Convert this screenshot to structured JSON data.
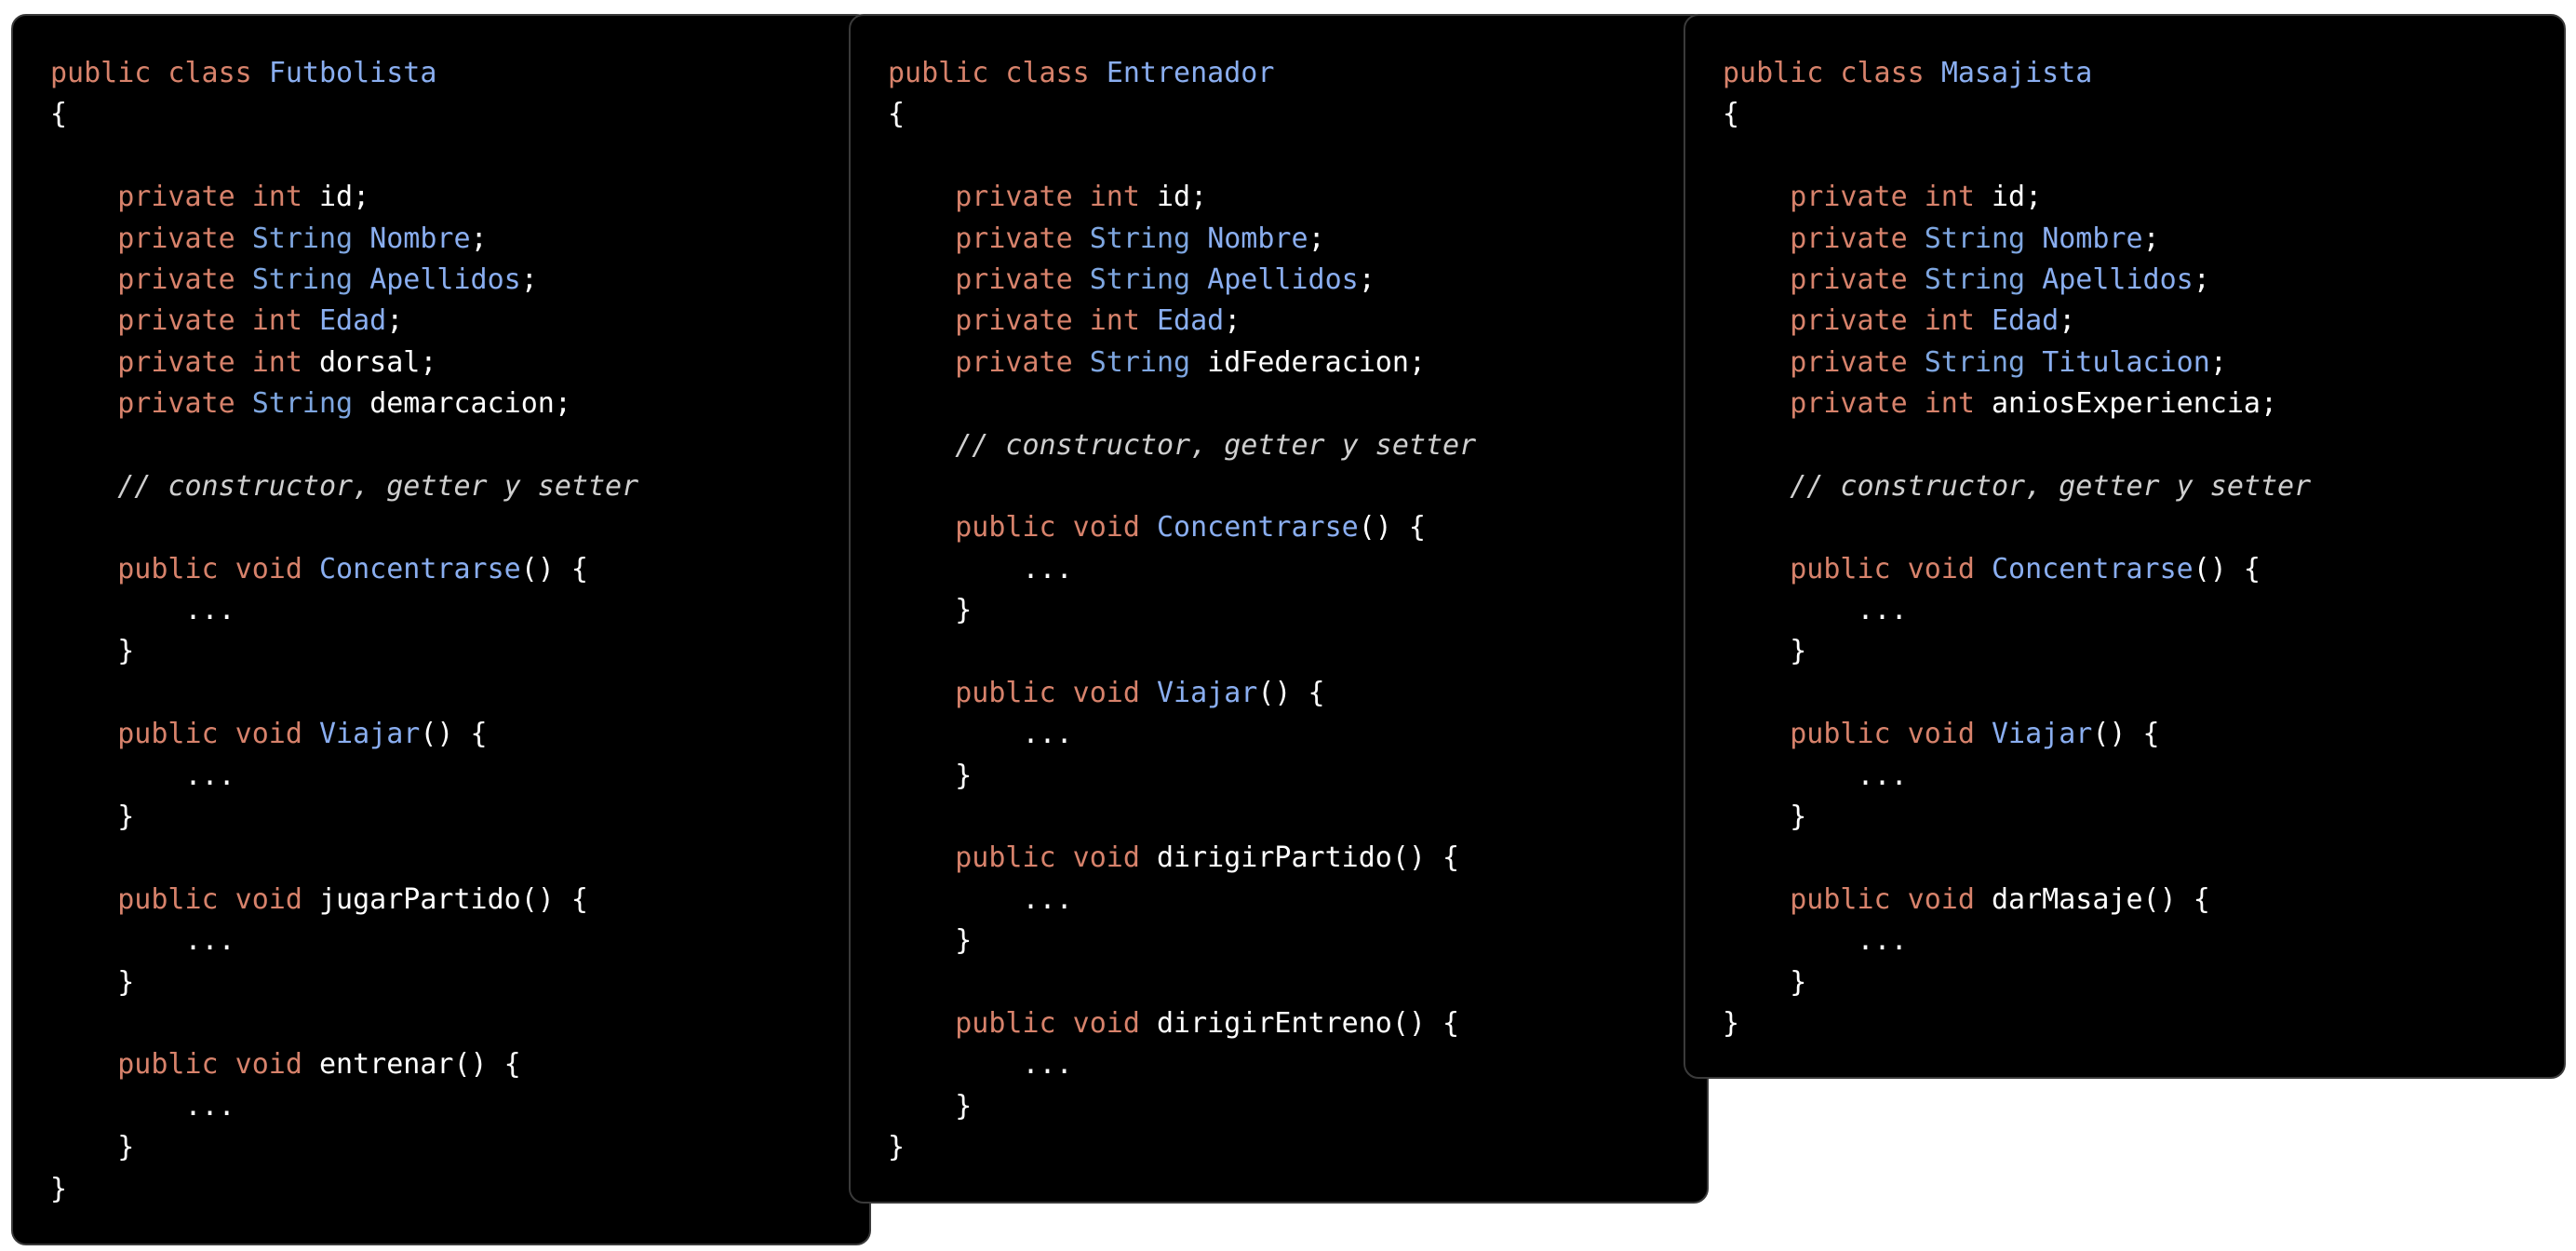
{
  "colors": {
    "background": "#ffffff",
    "panel": "#000000",
    "keyword": "#d7826b",
    "type": "#7ea6e0",
    "identifier": "#8aaef0",
    "plain": "#ffffff",
    "comment": "#cfcfcf"
  },
  "panels": [
    {
      "id": "futbolista",
      "lines": [
        [
          {
            "t": "kw",
            "v": "public class "
          },
          {
            "t": "name",
            "v": "Futbolista"
          }
        ],
        [
          {
            "t": "plain",
            "v": "{"
          }
        ],
        [],
        [
          {
            "t": "plain",
            "v": "\t"
          },
          {
            "t": "kw",
            "v": "private "
          },
          {
            "t": "kw",
            "v": "int "
          },
          {
            "t": "plain",
            "v": "id;"
          }
        ],
        [
          {
            "t": "plain",
            "v": "\t"
          },
          {
            "t": "kw",
            "v": "private "
          },
          {
            "t": "type",
            "v": "String "
          },
          {
            "t": "name",
            "v": "Nombre"
          },
          {
            "t": "plain",
            "v": ";"
          }
        ],
        [
          {
            "t": "plain",
            "v": "\t"
          },
          {
            "t": "kw",
            "v": "private "
          },
          {
            "t": "type",
            "v": "String "
          },
          {
            "t": "name",
            "v": "Apellidos"
          },
          {
            "t": "plain",
            "v": ";"
          }
        ],
        [
          {
            "t": "plain",
            "v": "\t"
          },
          {
            "t": "kw",
            "v": "private "
          },
          {
            "t": "kw",
            "v": "int "
          },
          {
            "t": "name",
            "v": "Edad"
          },
          {
            "t": "plain",
            "v": ";"
          }
        ],
        [
          {
            "t": "plain",
            "v": "\t"
          },
          {
            "t": "kw",
            "v": "private "
          },
          {
            "t": "kw",
            "v": "int "
          },
          {
            "t": "plain",
            "v": "dorsal;"
          }
        ],
        [
          {
            "t": "plain",
            "v": "\t"
          },
          {
            "t": "kw",
            "v": "private "
          },
          {
            "t": "type",
            "v": "String "
          },
          {
            "t": "plain",
            "v": "demarcacion;"
          }
        ],
        [],
        [
          {
            "t": "plain",
            "v": "\t"
          },
          {
            "t": "com",
            "v": "// constructor, getter y setter"
          }
        ],
        [],
        [
          {
            "t": "plain",
            "v": "\t"
          },
          {
            "t": "kw",
            "v": "public void "
          },
          {
            "t": "name",
            "v": "Concentrarse"
          },
          {
            "t": "plain",
            "v": "() {"
          }
        ],
        [
          {
            "t": "plain",
            "v": "\t\t..."
          }
        ],
        [
          {
            "t": "plain",
            "v": "\t}"
          }
        ],
        [],
        [
          {
            "t": "plain",
            "v": "\t"
          },
          {
            "t": "kw",
            "v": "public void "
          },
          {
            "t": "name",
            "v": "Viajar"
          },
          {
            "t": "plain",
            "v": "() {"
          }
        ],
        [
          {
            "t": "plain",
            "v": "\t\t..."
          }
        ],
        [
          {
            "t": "plain",
            "v": "\t}"
          }
        ],
        [],
        [
          {
            "t": "plain",
            "v": "\t"
          },
          {
            "t": "kw",
            "v": "public void "
          },
          {
            "t": "plain",
            "v": "jugarPartido() {"
          }
        ],
        [
          {
            "t": "plain",
            "v": "\t\t..."
          }
        ],
        [
          {
            "t": "plain",
            "v": "\t}"
          }
        ],
        [],
        [
          {
            "t": "plain",
            "v": "\t"
          },
          {
            "t": "kw",
            "v": "public void "
          },
          {
            "t": "plain",
            "v": "entrenar() {"
          }
        ],
        [
          {
            "t": "plain",
            "v": "\t\t..."
          }
        ],
        [
          {
            "t": "plain",
            "v": "\t}"
          }
        ],
        [
          {
            "t": "plain",
            "v": "}"
          }
        ]
      ]
    },
    {
      "id": "entrenador",
      "lines": [
        [
          {
            "t": "kw",
            "v": "public class "
          },
          {
            "t": "name",
            "v": "Entrenador"
          }
        ],
        [
          {
            "t": "plain",
            "v": "{"
          }
        ],
        [],
        [
          {
            "t": "plain",
            "v": "\t"
          },
          {
            "t": "kw",
            "v": "private "
          },
          {
            "t": "kw",
            "v": "int "
          },
          {
            "t": "plain",
            "v": "id;"
          }
        ],
        [
          {
            "t": "plain",
            "v": "\t"
          },
          {
            "t": "kw",
            "v": "private "
          },
          {
            "t": "type",
            "v": "String "
          },
          {
            "t": "name",
            "v": "Nombre"
          },
          {
            "t": "plain",
            "v": ";"
          }
        ],
        [
          {
            "t": "plain",
            "v": "\t"
          },
          {
            "t": "kw",
            "v": "private "
          },
          {
            "t": "type",
            "v": "String "
          },
          {
            "t": "name",
            "v": "Apellidos"
          },
          {
            "t": "plain",
            "v": ";"
          }
        ],
        [
          {
            "t": "plain",
            "v": "\t"
          },
          {
            "t": "kw",
            "v": "private "
          },
          {
            "t": "kw",
            "v": "int "
          },
          {
            "t": "name",
            "v": "Edad"
          },
          {
            "t": "plain",
            "v": ";"
          }
        ],
        [
          {
            "t": "plain",
            "v": "\t"
          },
          {
            "t": "kw",
            "v": "private "
          },
          {
            "t": "type",
            "v": "String "
          },
          {
            "t": "plain",
            "v": "idFederacion;"
          }
        ],
        [],
        [
          {
            "t": "plain",
            "v": "\t"
          },
          {
            "t": "com",
            "v": "// constructor, getter y setter"
          }
        ],
        [],
        [
          {
            "t": "plain",
            "v": "\t"
          },
          {
            "t": "kw",
            "v": "public void "
          },
          {
            "t": "name",
            "v": "Concentrarse"
          },
          {
            "t": "plain",
            "v": "() {"
          }
        ],
        [
          {
            "t": "plain",
            "v": "\t\t..."
          }
        ],
        [
          {
            "t": "plain",
            "v": "\t}"
          }
        ],
        [],
        [
          {
            "t": "plain",
            "v": "\t"
          },
          {
            "t": "kw",
            "v": "public void "
          },
          {
            "t": "name",
            "v": "Viajar"
          },
          {
            "t": "plain",
            "v": "() {"
          }
        ],
        [
          {
            "t": "plain",
            "v": "\t\t..."
          }
        ],
        [
          {
            "t": "plain",
            "v": "\t}"
          }
        ],
        [],
        [
          {
            "t": "plain",
            "v": "\t"
          },
          {
            "t": "kw",
            "v": "public void "
          },
          {
            "t": "plain",
            "v": "dirigirPartido() {"
          }
        ],
        [
          {
            "t": "plain",
            "v": "\t\t..."
          }
        ],
        [
          {
            "t": "plain",
            "v": "\t}"
          }
        ],
        [],
        [
          {
            "t": "plain",
            "v": "\t"
          },
          {
            "t": "kw",
            "v": "public void "
          },
          {
            "t": "plain",
            "v": "dirigirEntreno() {"
          }
        ],
        [
          {
            "t": "plain",
            "v": "\t\t..."
          }
        ],
        [
          {
            "t": "plain",
            "v": "\t}"
          }
        ],
        [
          {
            "t": "plain",
            "v": "}"
          }
        ]
      ]
    },
    {
      "id": "masajista",
      "lines": [
        [
          {
            "t": "kw",
            "v": "public class "
          },
          {
            "t": "name",
            "v": "Masajista"
          }
        ],
        [
          {
            "t": "plain",
            "v": "{"
          }
        ],
        [],
        [
          {
            "t": "plain",
            "v": "\t"
          },
          {
            "t": "kw",
            "v": "private "
          },
          {
            "t": "kw",
            "v": "int "
          },
          {
            "t": "plain",
            "v": "id;"
          }
        ],
        [
          {
            "t": "plain",
            "v": "\t"
          },
          {
            "t": "kw",
            "v": "private "
          },
          {
            "t": "type",
            "v": "String "
          },
          {
            "t": "name",
            "v": "Nombre"
          },
          {
            "t": "plain",
            "v": ";"
          }
        ],
        [
          {
            "t": "plain",
            "v": "\t"
          },
          {
            "t": "kw",
            "v": "private "
          },
          {
            "t": "type",
            "v": "String "
          },
          {
            "t": "name",
            "v": "Apellidos"
          },
          {
            "t": "plain",
            "v": ";"
          }
        ],
        [
          {
            "t": "plain",
            "v": "\t"
          },
          {
            "t": "kw",
            "v": "private "
          },
          {
            "t": "kw",
            "v": "int "
          },
          {
            "t": "name",
            "v": "Edad"
          },
          {
            "t": "plain",
            "v": ";"
          }
        ],
        [
          {
            "t": "plain",
            "v": "\t"
          },
          {
            "t": "kw",
            "v": "private "
          },
          {
            "t": "type",
            "v": "String "
          },
          {
            "t": "name",
            "v": "Titulacion"
          },
          {
            "t": "plain",
            "v": ";"
          }
        ],
        [
          {
            "t": "plain",
            "v": "\t"
          },
          {
            "t": "kw",
            "v": "private "
          },
          {
            "t": "kw",
            "v": "int "
          },
          {
            "t": "plain",
            "v": "aniosExperiencia;"
          }
        ],
        [],
        [
          {
            "t": "plain",
            "v": "\t"
          },
          {
            "t": "com",
            "v": "// constructor, getter y setter"
          }
        ],
        [],
        [
          {
            "t": "plain",
            "v": "\t"
          },
          {
            "t": "kw",
            "v": "public void "
          },
          {
            "t": "name",
            "v": "Concentrarse"
          },
          {
            "t": "plain",
            "v": "() {"
          }
        ],
        [
          {
            "t": "plain",
            "v": "\t\t..."
          }
        ],
        [
          {
            "t": "plain",
            "v": "\t}"
          }
        ],
        [],
        [
          {
            "t": "plain",
            "v": "\t"
          },
          {
            "t": "kw",
            "v": "public void "
          },
          {
            "t": "name",
            "v": "Viajar"
          },
          {
            "t": "plain",
            "v": "() {"
          }
        ],
        [
          {
            "t": "plain",
            "v": "\t\t..."
          }
        ],
        [
          {
            "t": "plain",
            "v": "\t}"
          }
        ],
        [],
        [
          {
            "t": "plain",
            "v": "\t"
          },
          {
            "t": "kw",
            "v": "public void "
          },
          {
            "t": "plain",
            "v": "darMasaje() {"
          }
        ],
        [
          {
            "t": "plain",
            "v": "\t\t..."
          }
        ],
        [
          {
            "t": "plain",
            "v": "\t}"
          }
        ],
        [
          {
            "t": "plain",
            "v": "}"
          }
        ]
      ]
    }
  ]
}
